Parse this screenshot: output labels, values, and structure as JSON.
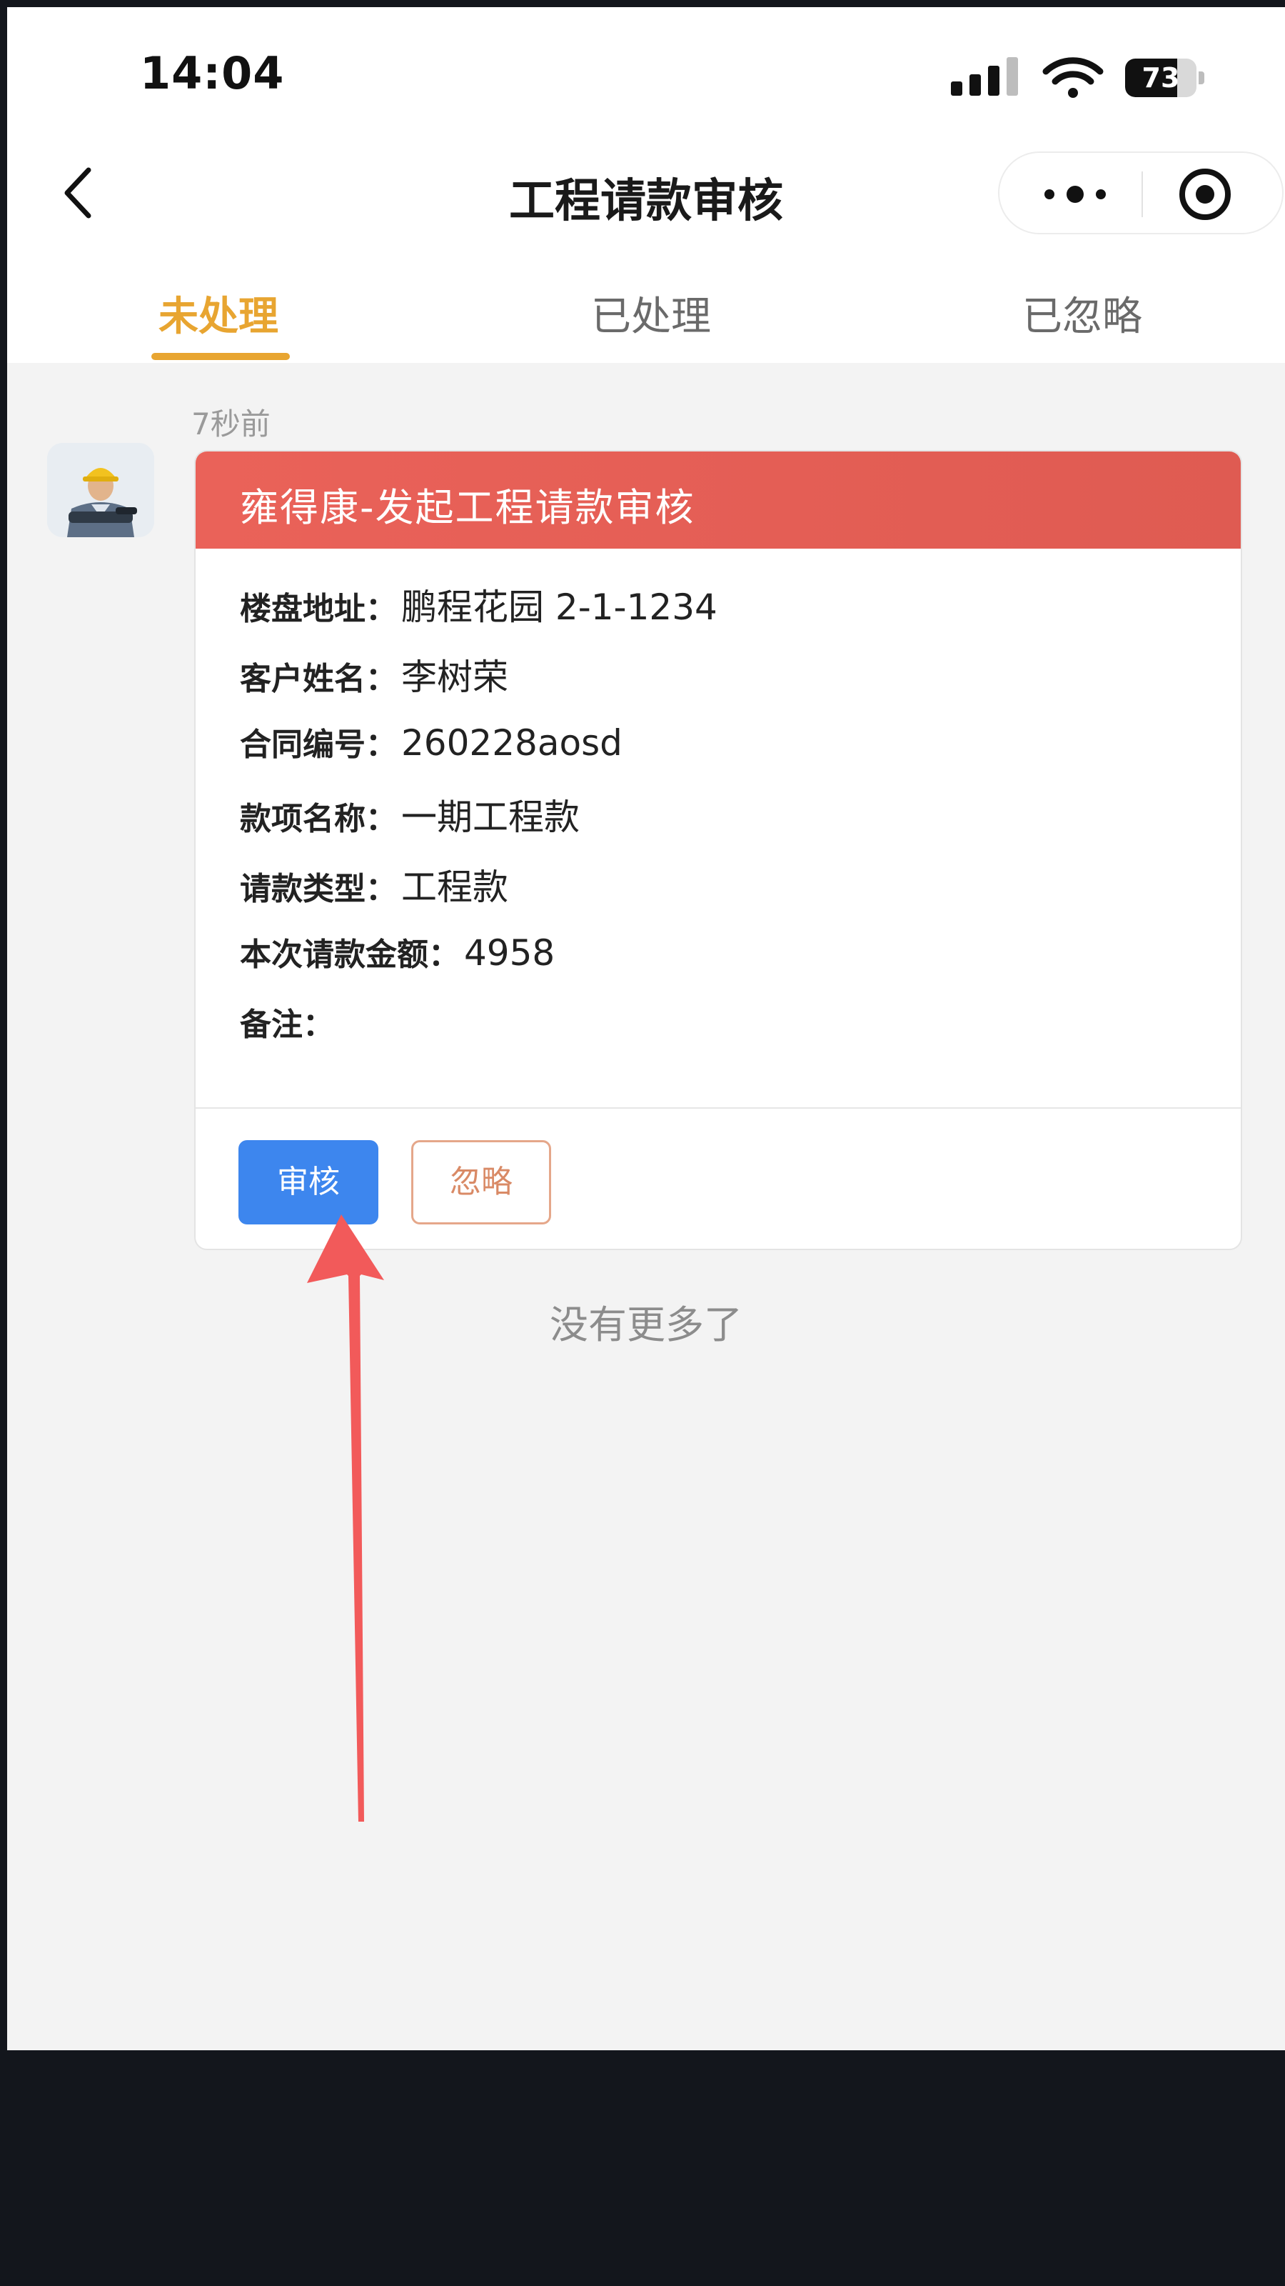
{
  "status_bar": {
    "time": "14:04",
    "battery": "73",
    "battery_level_percent": 73
  },
  "nav": {
    "title": "工程请款审核",
    "back_icon": "chevron-left-icon",
    "more_icon": "more-dots-icon",
    "target_icon": "target-circle-icon"
  },
  "tabs": [
    {
      "label": "未处理",
      "active": true
    },
    {
      "label": "已处理",
      "active": false
    },
    {
      "label": "已忽略",
      "active": false
    }
  ],
  "colors": {
    "accent": "#e8a531",
    "card_header": "#e05c53",
    "primary_button": "#3d86ee",
    "ignore_button": "#d98a66",
    "annotation_arrow": "#f25a5a"
  },
  "message": {
    "timestamp": "7秒前",
    "card_title": "雍得康-发起工程请款审核",
    "fields": [
      {
        "label": "楼盘地址：",
        "value": "鹏程花园 2-1-1234"
      },
      {
        "label": "客户姓名：",
        "value": "李树荣"
      },
      {
        "label": "合同编号：",
        "value": "260228aosd"
      },
      {
        "label": "款项名称：",
        "value": "一期工程款"
      },
      {
        "label": "请款类型：",
        "value": "工程款"
      },
      {
        "label": "本次请款金额：",
        "value": "4958"
      },
      {
        "label": "备注：",
        "value": ""
      }
    ],
    "approve_label": "审核",
    "ignore_label": "忽略"
  },
  "footer": {
    "no_more": "没有更多了"
  }
}
